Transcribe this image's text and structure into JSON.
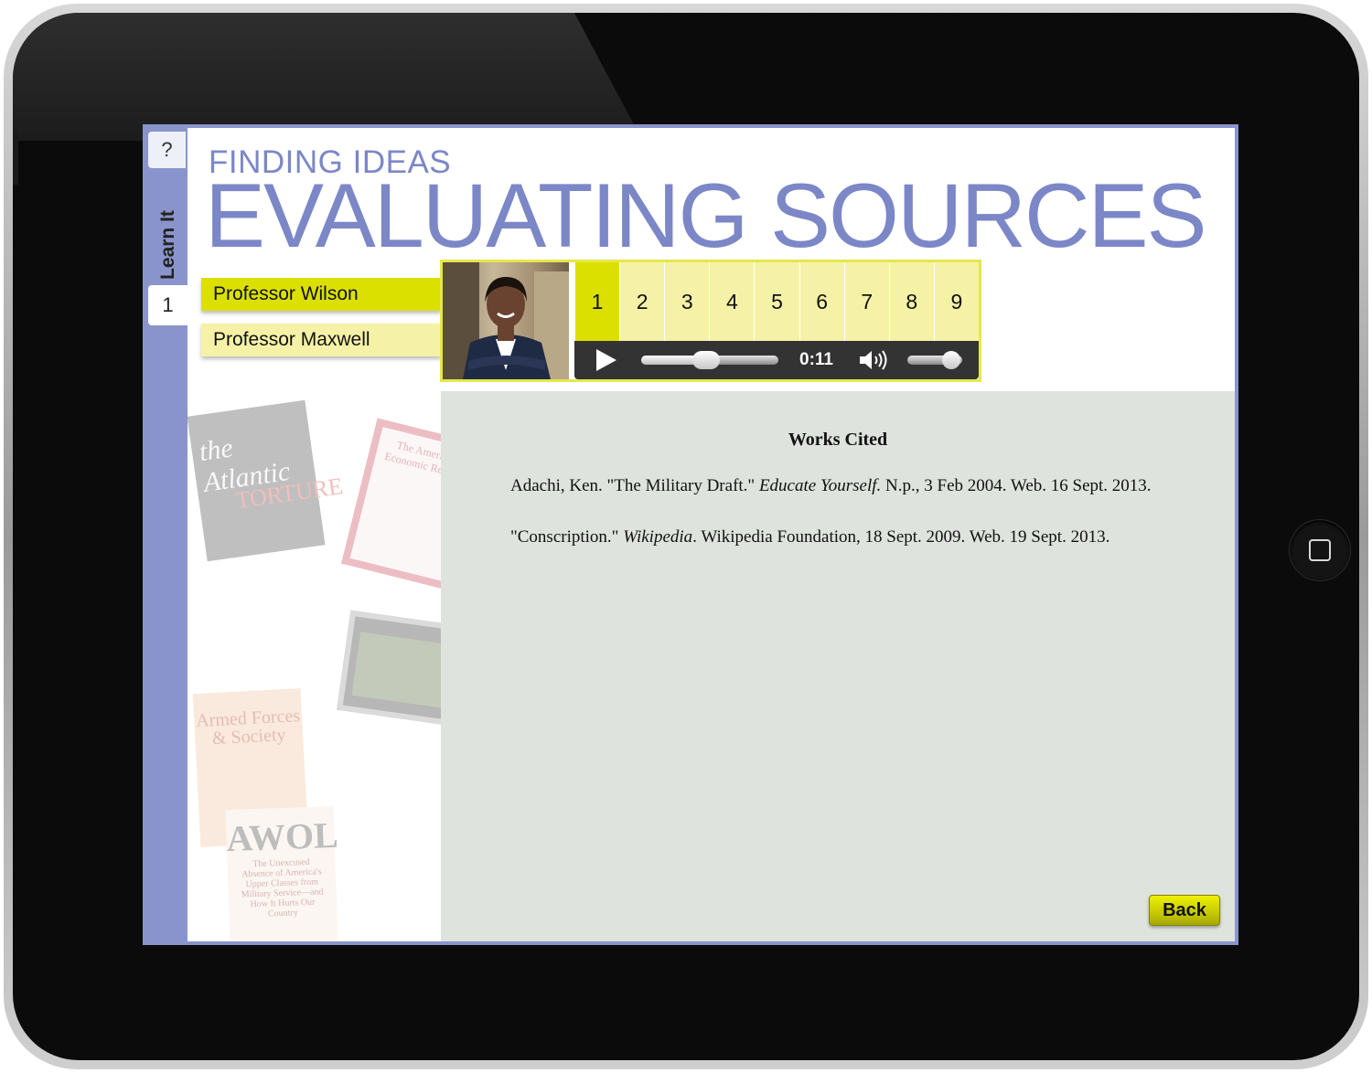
{
  "module": {
    "title_small": "FINDING IDEAS",
    "title_big": "EVALUATING SOURCES"
  },
  "sidebar": {
    "help_label": "?",
    "section_label": "Learn It",
    "page_label": "1"
  },
  "professors": [
    {
      "label": "Professor Wilson",
      "selected": true
    },
    {
      "label": "Professor Maxwell",
      "selected": false
    }
  ],
  "player": {
    "chapters": [
      "1",
      "2",
      "3",
      "4",
      "5",
      "6",
      "7",
      "8",
      "9"
    ],
    "active_chapter": "1",
    "time": "0:11",
    "seek_progress": 0.47,
    "volume_level": 0.8
  },
  "works_cited": {
    "heading": "Works Cited",
    "entries": [
      {
        "pre": "Adachi, Ken. \"The Military Draft.\" ",
        "italic": "Educate Yourself.",
        "post": " N.p., 3 Feb 2004. Web. 16 Sept. 2013."
      },
      {
        "pre": "\"Conscription.\" ",
        "italic": "Wikipedia",
        "post": ". Wikipedia Foundation, 18 Sept. 2009. Web. 19 Sept. 2013."
      }
    ]
  },
  "back_label": "Back",
  "collage": {
    "mag1_title": "the Atlantic",
    "mag1_word": "TORTURE",
    "mag2_title": "The American Economic Review",
    "mag4_title": "Armed Forces & Society",
    "mag5_title": "AWOL",
    "mag5_sub": "The Unexcused Absence of America's Upper Classes from Military Service—and How It Hurts Our Country"
  },
  "colors": {
    "accent_blue": "#8a94cc",
    "title_blue": "#7c87c7",
    "yellow_active": "#dbe000",
    "yellow_light": "#f5f2a8",
    "panel_gray": "#dee3dd",
    "player_bar": "#333333"
  },
  "icons": {
    "play": "play-icon",
    "volume": "volume-icon",
    "home": "home-button-icon"
  }
}
